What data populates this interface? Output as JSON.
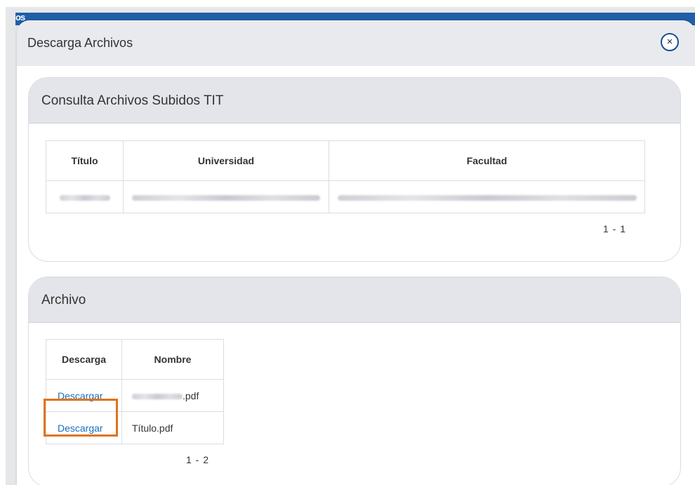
{
  "background": {
    "logo_text": "os"
  },
  "modal": {
    "title": "Descarga Archivos",
    "close_label": "×"
  },
  "uploaded_files_panel": {
    "title": "Consulta Archivos Subidos TIT",
    "columns": [
      "Título",
      "Universidad",
      "Facultad"
    ],
    "pagination": "1 - 1"
  },
  "file_panel": {
    "title": "Archivo",
    "columns": [
      "Descarga",
      "Nombre"
    ],
    "rows": [
      {
        "action": "Descargar",
        "filename_suffix": ".pdf"
      },
      {
        "action": "Descargar",
        "filename": "Título.pdf"
      }
    ],
    "pagination": "1 - 2"
  },
  "colors": {
    "link": "#1a6ec0",
    "highlight": "#e07318",
    "header_bg": "#e9eaee",
    "close_border": "#1a4f95"
  }
}
